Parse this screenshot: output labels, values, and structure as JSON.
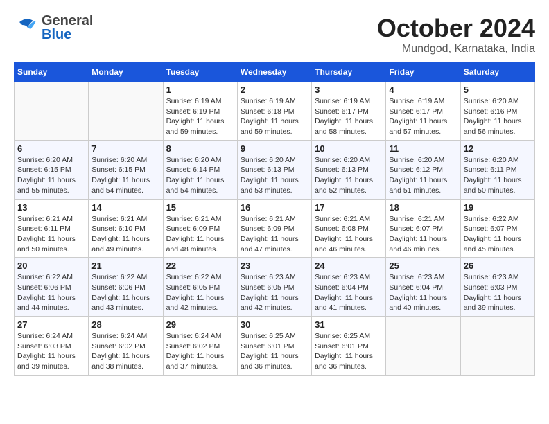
{
  "header": {
    "logo_general": "General",
    "logo_blue": "Blue",
    "month_year": "October 2024",
    "location": "Mundgod, Karnataka, India"
  },
  "weekdays": [
    "Sunday",
    "Monday",
    "Tuesday",
    "Wednesday",
    "Thursday",
    "Friday",
    "Saturday"
  ],
  "weeks": [
    [
      {
        "day": "",
        "sunrise": "",
        "sunset": "",
        "daylight": ""
      },
      {
        "day": "",
        "sunrise": "",
        "sunset": "",
        "daylight": ""
      },
      {
        "day": "1",
        "sunrise": "Sunrise: 6:19 AM",
        "sunset": "Sunset: 6:19 PM",
        "daylight": "Daylight: 11 hours and 59 minutes."
      },
      {
        "day": "2",
        "sunrise": "Sunrise: 6:19 AM",
        "sunset": "Sunset: 6:18 PM",
        "daylight": "Daylight: 11 hours and 59 minutes."
      },
      {
        "day": "3",
        "sunrise": "Sunrise: 6:19 AM",
        "sunset": "Sunset: 6:17 PM",
        "daylight": "Daylight: 11 hours and 58 minutes."
      },
      {
        "day": "4",
        "sunrise": "Sunrise: 6:19 AM",
        "sunset": "Sunset: 6:17 PM",
        "daylight": "Daylight: 11 hours and 57 minutes."
      },
      {
        "day": "5",
        "sunrise": "Sunrise: 6:20 AM",
        "sunset": "Sunset: 6:16 PM",
        "daylight": "Daylight: 11 hours and 56 minutes."
      }
    ],
    [
      {
        "day": "6",
        "sunrise": "Sunrise: 6:20 AM",
        "sunset": "Sunset: 6:15 PM",
        "daylight": "Daylight: 11 hours and 55 minutes."
      },
      {
        "day": "7",
        "sunrise": "Sunrise: 6:20 AM",
        "sunset": "Sunset: 6:15 PM",
        "daylight": "Daylight: 11 hours and 54 minutes."
      },
      {
        "day": "8",
        "sunrise": "Sunrise: 6:20 AM",
        "sunset": "Sunset: 6:14 PM",
        "daylight": "Daylight: 11 hours and 54 minutes."
      },
      {
        "day": "9",
        "sunrise": "Sunrise: 6:20 AM",
        "sunset": "Sunset: 6:13 PM",
        "daylight": "Daylight: 11 hours and 53 minutes."
      },
      {
        "day": "10",
        "sunrise": "Sunrise: 6:20 AM",
        "sunset": "Sunset: 6:13 PM",
        "daylight": "Daylight: 11 hours and 52 minutes."
      },
      {
        "day": "11",
        "sunrise": "Sunrise: 6:20 AM",
        "sunset": "Sunset: 6:12 PM",
        "daylight": "Daylight: 11 hours and 51 minutes."
      },
      {
        "day": "12",
        "sunrise": "Sunrise: 6:20 AM",
        "sunset": "Sunset: 6:11 PM",
        "daylight": "Daylight: 11 hours and 50 minutes."
      }
    ],
    [
      {
        "day": "13",
        "sunrise": "Sunrise: 6:21 AM",
        "sunset": "Sunset: 6:11 PM",
        "daylight": "Daylight: 11 hours and 50 minutes."
      },
      {
        "day": "14",
        "sunrise": "Sunrise: 6:21 AM",
        "sunset": "Sunset: 6:10 PM",
        "daylight": "Daylight: 11 hours and 49 minutes."
      },
      {
        "day": "15",
        "sunrise": "Sunrise: 6:21 AM",
        "sunset": "Sunset: 6:09 PM",
        "daylight": "Daylight: 11 hours and 48 minutes."
      },
      {
        "day": "16",
        "sunrise": "Sunrise: 6:21 AM",
        "sunset": "Sunset: 6:09 PM",
        "daylight": "Daylight: 11 hours and 47 minutes."
      },
      {
        "day": "17",
        "sunrise": "Sunrise: 6:21 AM",
        "sunset": "Sunset: 6:08 PM",
        "daylight": "Daylight: 11 hours and 46 minutes."
      },
      {
        "day": "18",
        "sunrise": "Sunrise: 6:21 AM",
        "sunset": "Sunset: 6:07 PM",
        "daylight": "Daylight: 11 hours and 46 minutes."
      },
      {
        "day": "19",
        "sunrise": "Sunrise: 6:22 AM",
        "sunset": "Sunset: 6:07 PM",
        "daylight": "Daylight: 11 hours and 45 minutes."
      }
    ],
    [
      {
        "day": "20",
        "sunrise": "Sunrise: 6:22 AM",
        "sunset": "Sunset: 6:06 PM",
        "daylight": "Daylight: 11 hours and 44 minutes."
      },
      {
        "day": "21",
        "sunrise": "Sunrise: 6:22 AM",
        "sunset": "Sunset: 6:06 PM",
        "daylight": "Daylight: 11 hours and 43 minutes."
      },
      {
        "day": "22",
        "sunrise": "Sunrise: 6:22 AM",
        "sunset": "Sunset: 6:05 PM",
        "daylight": "Daylight: 11 hours and 42 minutes."
      },
      {
        "day": "23",
        "sunrise": "Sunrise: 6:23 AM",
        "sunset": "Sunset: 6:05 PM",
        "daylight": "Daylight: 11 hours and 42 minutes."
      },
      {
        "day": "24",
        "sunrise": "Sunrise: 6:23 AM",
        "sunset": "Sunset: 6:04 PM",
        "daylight": "Daylight: 11 hours and 41 minutes."
      },
      {
        "day": "25",
        "sunrise": "Sunrise: 6:23 AM",
        "sunset": "Sunset: 6:04 PM",
        "daylight": "Daylight: 11 hours and 40 minutes."
      },
      {
        "day": "26",
        "sunrise": "Sunrise: 6:23 AM",
        "sunset": "Sunset: 6:03 PM",
        "daylight": "Daylight: 11 hours and 39 minutes."
      }
    ],
    [
      {
        "day": "27",
        "sunrise": "Sunrise: 6:24 AM",
        "sunset": "Sunset: 6:03 PM",
        "daylight": "Daylight: 11 hours and 39 minutes."
      },
      {
        "day": "28",
        "sunrise": "Sunrise: 6:24 AM",
        "sunset": "Sunset: 6:02 PM",
        "daylight": "Daylight: 11 hours and 38 minutes."
      },
      {
        "day": "29",
        "sunrise": "Sunrise: 6:24 AM",
        "sunset": "Sunset: 6:02 PM",
        "daylight": "Daylight: 11 hours and 37 minutes."
      },
      {
        "day": "30",
        "sunrise": "Sunrise: 6:25 AM",
        "sunset": "Sunset: 6:01 PM",
        "daylight": "Daylight: 11 hours and 36 minutes."
      },
      {
        "day": "31",
        "sunrise": "Sunrise: 6:25 AM",
        "sunset": "Sunset: 6:01 PM",
        "daylight": "Daylight: 11 hours and 36 minutes."
      },
      {
        "day": "",
        "sunrise": "",
        "sunset": "",
        "daylight": ""
      },
      {
        "day": "",
        "sunrise": "",
        "sunset": "",
        "daylight": ""
      }
    ]
  ]
}
